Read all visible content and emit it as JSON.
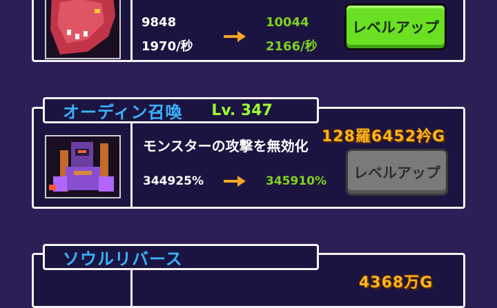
{
  "upgrades": [
    {
      "stat_current": "9848",
      "stat_next": "10044",
      "rate_current": "1970/秒",
      "rate_next": "2166/秒",
      "button_label": "レベルアップ",
      "button_enabled": true
    },
    {
      "name": "オーディン召喚",
      "level": "Lv. 347",
      "cost": "128羅6452衿G",
      "description": "モンスターの攻撃を無効化",
      "value_current": "344925%",
      "value_next": "345910%",
      "button_label": "レベルアップ",
      "button_enabled": false
    },
    {
      "name": "ソウルリバース",
      "cost_partial": "4368万G"
    }
  ],
  "colors": {
    "background": "#2d1f55",
    "panel": "#1c1440",
    "title": "#39b3ff",
    "level": "#99ff33",
    "next_value": "#7ed321",
    "cost": "#ffb41f",
    "arrow": "#f5a623"
  }
}
